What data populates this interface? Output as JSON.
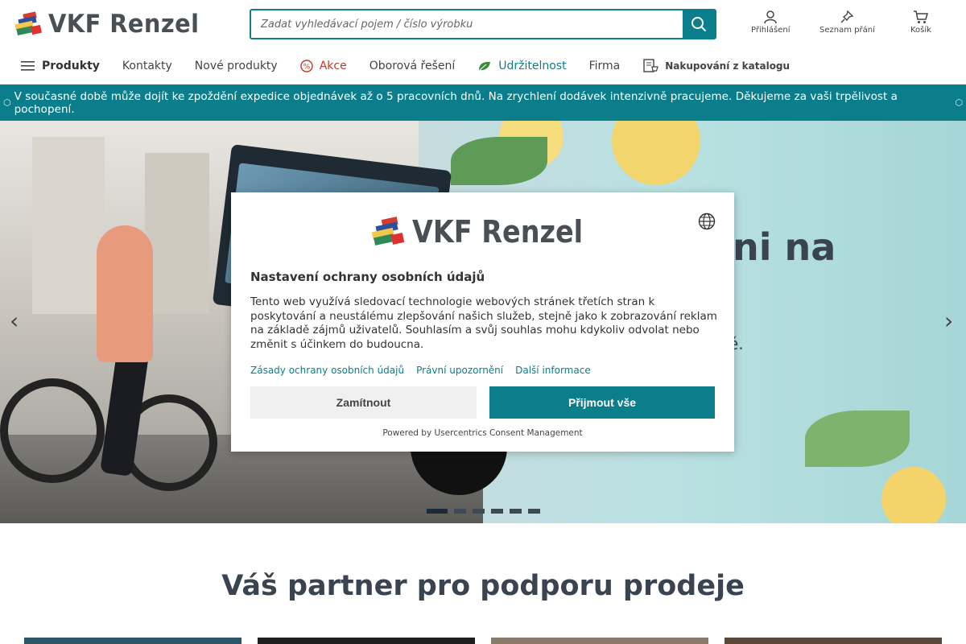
{
  "header": {
    "brand": "VKF Renzel",
    "search_placeholder": "Zadat vyhledávací pojem / číslo výrobku",
    "login_label": "Přihlášení",
    "wishlist_label": "Seznam přání",
    "cart_label": "Košík"
  },
  "nav": {
    "items": [
      {
        "label": "Produkty",
        "icon": "menu-icon"
      },
      {
        "label": "Kontakty"
      },
      {
        "label": "Nové produkty"
      },
      {
        "label": "Akce",
        "icon": "percent-icon"
      },
      {
        "label": "Oborová řešení"
      },
      {
        "label": "Udržitelnost",
        "icon": "leaf-icon"
      },
      {
        "label": "Firma"
      },
      {
        "label": "Nakupování z katalogu",
        "icon": "catalog-icon"
      }
    ]
  },
  "notice": {
    "text": "V současné době může dojít ke zpoždění expedice objednávek až o 5 pracovních dnů. Na zrychlení dodávek intenzivně pracujeme. Děkujeme za vaši trpělivost a pochopení."
  },
  "hero": {
    "headline_fragment": "ni na",
    "sub_fragment": "ě.",
    "slide_count": 6,
    "active_slide": 1
  },
  "consent": {
    "brand": "VKF Renzel",
    "title": "Nastavení ochrany osobních údajů",
    "body": "Tento web využívá sledovací technologie webových stránek třetích stran k poskytování a neustálému zlepšování našich služeb, stejně jako k zobrazování reklam na základě zájmů uživatelů. Souhlasím a svůj souhlas mohu kdykoliv odvolat nebo změnit s účinkem do budoucna.",
    "links": [
      "Zásady ochrany osobních údajů",
      "Právní upozornění",
      "Další informace"
    ],
    "deny_label": "Zamítnout",
    "accept_label": "Přijmout vše",
    "powered_by": "Powered by Usercentrics Consent Management"
  },
  "section": {
    "title": "Váš partner pro podporu prodeje"
  },
  "colors": {
    "accent": "#0b7e8c",
    "sale": "#c0392b",
    "text_dark": "#3a4450"
  }
}
